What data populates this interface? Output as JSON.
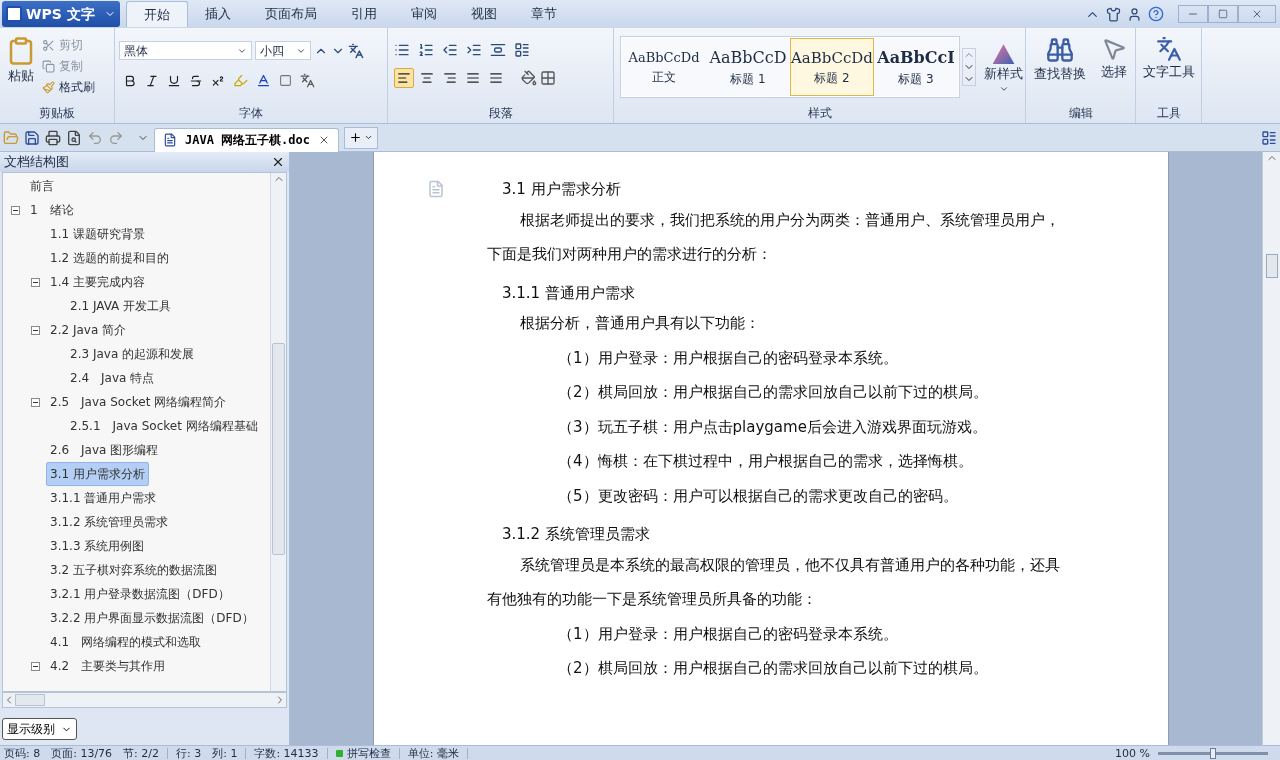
{
  "app_menu": "WPS 文字",
  "ribbon_tabs": [
    {
      "label": "开始",
      "selected": true
    },
    {
      "label": "插入",
      "selected": false
    },
    {
      "label": "页面布局",
      "selected": false
    },
    {
      "label": "引用",
      "selected": false
    },
    {
      "label": "审阅",
      "selected": false
    },
    {
      "label": "视图",
      "selected": false
    },
    {
      "label": "章节",
      "selected": false
    }
  ],
  "clipboard": {
    "paste": "粘贴",
    "cut": "剪切",
    "copy": "复制",
    "format_painter": "格式刷",
    "label": "剪贴板"
  },
  "font": {
    "font_name": "黑体",
    "font_size": "小四",
    "label": "字体"
  },
  "paragraph": {
    "label": "段落",
    "alignment_buttons": [
      {
        "selected": true
      },
      {
        "selected": false
      },
      {
        "selected": false
      },
      {
        "selected": false
      },
      {
        "selected": false
      }
    ]
  },
  "styles": {
    "label": "样式",
    "items": [
      {
        "preview": "AaBbCcDd",
        "name": "正文",
        "selected": false
      },
      {
        "preview": "AaBbCcD",
        "name": "标题 1",
        "selected": false
      },
      {
        "preview": "AaBbCcDd",
        "name": "标题 2",
        "selected": true
      },
      {
        "preview": "AaBbCcI",
        "name": "标题 3",
        "selected": false
      }
    ],
    "new_style": "新样式"
  },
  "edit": {
    "label": "编辑",
    "find_replace": "查找替换",
    "select": "选择"
  },
  "tools": {
    "label": "工具",
    "text_tools": "文字工具"
  },
  "document_tab": "JAVA 网络五子棋.doc",
  "nav_pane": {
    "title": "文档结构图",
    "level_button": "显示级别",
    "items": [
      {
        "label": "前言",
        "selected": false
      },
      {
        "label": "1　绪论",
        "selected": false,
        "expanded": true,
        "children": [
          {
            "label": "1.1 课题研究背景",
            "selected": false
          },
          {
            "label": "1.2 选题的前提和目的",
            "selected": false
          },
          {
            "label": "1.4 主要完成内容",
            "selected": false,
            "expanded": true,
            "children": [
              {
                "label": "2.1 JAVA 开发工具",
                "selected": false
              }
            ]
          },
          {
            "label": "2.2 Java 简介",
            "selected": false,
            "expanded": true,
            "children": [
              {
                "label": "2.3 Java 的起源和发展",
                "selected": false
              },
              {
                "label": "2.4　Java 特点",
                "selected": false
              }
            ]
          },
          {
            "label": "2.5　Java Socket 网络编程简介",
            "selected": false,
            "expanded": true,
            "children": [
              {
                "label": "2.5.1　Java Socket 网络编程基础",
                "selected": false
              }
            ]
          },
          {
            "label": "2.6　Java 图形编程",
            "selected": false
          },
          {
            "label": "3.1 用户需求分析",
            "selected": true
          },
          {
            "label": "3.1.1 普通用户需求",
            "selected": false
          },
          {
            "label": "3.1.2 系统管理员需求",
            "selected": false
          },
          {
            "label": "3.1.3 系统用例图",
            "selected": false
          },
          {
            "label": "3.2 五子棋对弈系统的数据流图",
            "selected": false
          },
          {
            "label": "3.2.1 用户登录数据流图（DFD）",
            "selected": false
          },
          {
            "label": "3.2.2 用户界面显示数据流图（DFD）",
            "selected": false
          },
          {
            "label": "4.1　网络编程的模式和选取",
            "selected": false
          },
          {
            "label": "4.2　主要类与其作用",
            "selected": false,
            "expanded": true
          }
        ]
      }
    ]
  },
  "document": [
    {
      "kind": "heading",
      "text": "3.1 用户需求分析"
    },
    {
      "kind": "indent",
      "text": "根据老师提出的要求，我们把系统的用户分为两类：普通用户、系统管理员用户，"
    },
    {
      "kind": "flush",
      "text": "下面是我们对两种用户的需求进行的分析："
    },
    {
      "kind": "heading",
      "text": "3.1.1 普通用户需求"
    },
    {
      "kind": "indent",
      "text": "根据分析，普通用户具有以下功能："
    },
    {
      "kind": "item",
      "text": "（1）用户登录：用户根据自己的密码登录本系统。"
    },
    {
      "kind": "item",
      "text": "（2）棋局回放：用户根据自己的需求回放自己以前下过的棋局。"
    },
    {
      "kind": "item",
      "text": "（3）玩五子棋：用户点击playgame后会进入游戏界面玩游戏。"
    },
    {
      "kind": "item",
      "text": "（4）悔棋：在下棋过程中，用户根据自己的需求，选择悔棋。"
    },
    {
      "kind": "item",
      "text": "（5）更改密码：用户可以根据自己的需求更改自己的密码。"
    },
    {
      "kind": "heading",
      "text": "3.1.2 系统管理员需求"
    },
    {
      "kind": "indent",
      "text": "系统管理员是本系统的最高权限的管理员，他不仅具有普通用户的各种功能，还具"
    },
    {
      "kind": "flush",
      "text": "有他独有的功能一下是系统管理员所具备的功能："
    },
    {
      "kind": "item",
      "text": "（1）用户登录：用户根据自己的密码登录本系统。"
    },
    {
      "kind": "item",
      "text": "（2）棋局回放：用户根据自己的需求回放自己以前下过的棋局。"
    }
  ],
  "status_bar": [
    {
      "kind": "text",
      "text": "页码: 8　页面: 13/76　节: 2/2"
    },
    {
      "kind": "text",
      "text": "行: 3　列: 1"
    },
    {
      "kind": "text",
      "text": "字数: 14133"
    },
    {
      "kind": "indicator",
      "text": "拼写检查"
    },
    {
      "kind": "text",
      "text": "单位: 毫米"
    }
  ],
  "zoom": "100 %",
  "zoom_slider": {
    "level": 0.5
  }
}
